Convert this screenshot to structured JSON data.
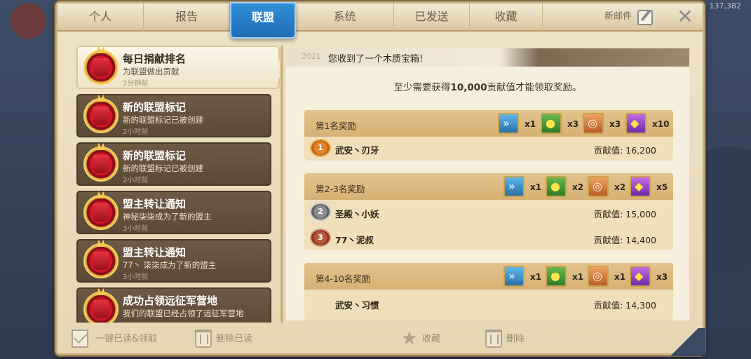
{
  "background": {
    "coordinates": "137,382"
  },
  "tabs": [
    {
      "label": "个人"
    },
    {
      "label": "报告"
    },
    {
      "label": "联盟"
    },
    {
      "label": "系统"
    },
    {
      "label": "已发送"
    },
    {
      "label": "收藏"
    }
  ],
  "active_tab": "联盟",
  "header": {
    "new_mail_label": "新邮件",
    "close_symbol": "✕"
  },
  "mail_list": [
    {
      "title": "每日捐献排名",
      "desc": "为联盟做出贡献",
      "time": "7分钟前",
      "selected": true
    },
    {
      "title": "新的联盟标记",
      "desc": "新的联盟标记已被创建",
      "time": "2小时前"
    },
    {
      "title": "新的联盟标记",
      "desc": "新的联盟标记已被创建",
      "time": "2小时前"
    },
    {
      "title": "盟主转让通知",
      "desc": "神秘柒柒成为了新的盟主",
      "time": "3小时前"
    },
    {
      "title": "盟主转让通知",
      "desc": "77丶 柒柒成为了新的盟主",
      "time": "3小时前"
    },
    {
      "title": "成功占领远征军营地",
      "desc": "我们的联盟已经占领了远征军营地",
      "time": ""
    }
  ],
  "detail": {
    "year": "2021",
    "title": "您收到了一个木质宝箱!",
    "requirement_prefix": "至少需要获得",
    "requirement_amount": "10,000",
    "requirement_suffix": "贡献值才能领取奖励。",
    "tiers": [
      {
        "name": "第1名奖励",
        "rewards": [
          {
            "icon": "speedup-icon",
            "count": "x1"
          },
          {
            "icon": "food-icon",
            "count": "x3"
          },
          {
            "icon": "wood-icon",
            "count": "x3"
          },
          {
            "icon": "gem-icon",
            "count": "x10"
          }
        ],
        "ranks": [
          {
            "medal": "1",
            "name": "武安丶刃牙",
            "score": "贡献值: 16,200"
          }
        ]
      },
      {
        "name": "第2-3名奖励",
        "rewards": [
          {
            "icon": "speedup-icon",
            "count": "x1"
          },
          {
            "icon": "food-icon",
            "count": "x2"
          },
          {
            "icon": "wood-icon",
            "count": "x2"
          },
          {
            "icon": "gem-icon",
            "count": "x5"
          }
        ],
        "ranks": [
          {
            "medal": "2",
            "name": "圣殿丶小妖",
            "score": "贡献值: 15,000"
          },
          {
            "medal": "3",
            "name": "77丶泥叔",
            "score": "贡献值: 14,400"
          }
        ]
      },
      {
        "name": "第4-10名奖励",
        "rewards": [
          {
            "icon": "speedup-icon",
            "count": "x1"
          },
          {
            "icon": "food-icon",
            "count": "x1"
          },
          {
            "icon": "wood-icon",
            "count": "x1"
          },
          {
            "icon": "gem-icon",
            "count": "x3"
          }
        ],
        "ranks": [
          {
            "medal": "",
            "name": "武安丶习惯",
            "score": "贡献值: 14,300"
          }
        ]
      }
    ]
  },
  "bottom_actions": {
    "read_all_claim": "一键已读&领取",
    "delete_read": "删除已读",
    "favorite": "收藏",
    "delete": "删除"
  },
  "colors": {
    "active_tab": "#1f6db5",
    "mail_item_bg": "#5a4936",
    "tier_header": "#d6b174",
    "reward_border": "#c9a24c"
  }
}
